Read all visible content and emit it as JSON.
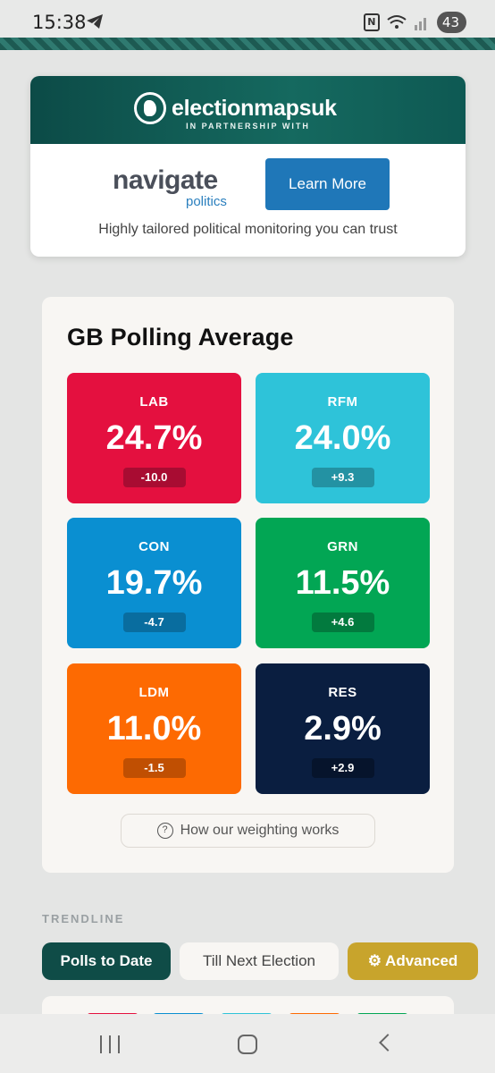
{
  "status_bar": {
    "time": "15:38",
    "battery": "43",
    "icons": [
      "telegram-icon",
      "nfc-icon",
      "wifi-icon",
      "signal-icon",
      "battery-icon"
    ]
  },
  "ad": {
    "brand": "electionmapsuk",
    "partnership": "IN PARTNERSHIP WITH",
    "partner_word1": "navigate",
    "partner_word2": "politics",
    "cta": "Learn More",
    "tagline": "Highly tailored political monitoring you can trust"
  },
  "polling": {
    "title": "GB Polling Average",
    "parties": [
      {
        "name": "LAB",
        "pct": "24.7%",
        "change": "-10.0",
        "color": "#e4103f",
        "badge": "#a80c32"
      },
      {
        "name": "RFM",
        "pct": "24.0%",
        "change": "+9.3",
        "color": "#2ec3d9",
        "badge": "#2392a3"
      },
      {
        "name": "CON",
        "pct": "19.7%",
        "change": "-4.7",
        "color": "#0a8fd1",
        "badge": "#096d9f"
      },
      {
        "name": "GRN",
        "pct": "11.5%",
        "change": "+4.6",
        "color": "#02a654",
        "badge": "#027a3e"
      },
      {
        "name": "LDM",
        "pct": "11.0%",
        "change": "-1.5",
        "color": "#fd6a02",
        "badge": "#c04f02"
      },
      {
        "name": "RES",
        "pct": "2.9%",
        "change": "+2.9",
        "color": "#0a1e40",
        "badge": "#06142c"
      }
    ],
    "weighting_link": "How our weighting works"
  },
  "trendline": {
    "label": "TRENDLINE",
    "tabs": [
      "Polls to Date",
      "Till Next Election",
      "Advanced"
    ],
    "advanced_icon": "gear-icon"
  }
}
